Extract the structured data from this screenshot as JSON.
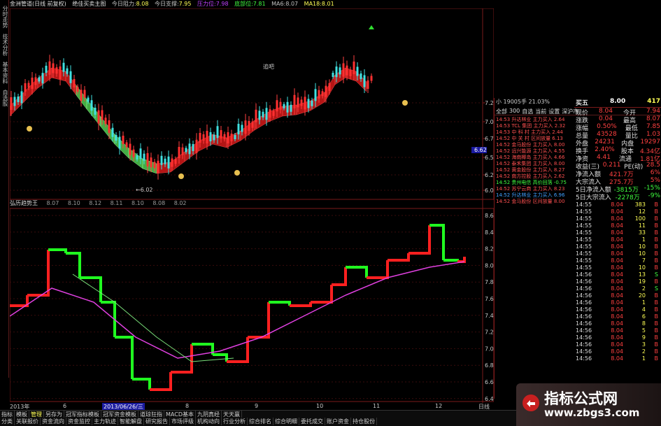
{
  "left_rail": [
    "分时走势",
    "技术分析",
    "基本资料",
    "自选股"
  ],
  "top_bar": {
    "title": "金洲管道(日线 前复权)",
    "indicator": "绝佳买卖主图",
    "today_pressure_label": "今日阻力:",
    "today_pressure": "8.08",
    "today_support_label": "今日支撑:",
    "today_support": "7.95",
    "pressure_label": "压力位:",
    "pressure": "7.98",
    "support_label": "底部位:",
    "support": "7.81",
    "ma6_label": "MA6:",
    "ma6": "8.07",
    "ma18_label": "MA18:",
    "ma18": "8.01"
  },
  "main_chart": {
    "price_axis": [
      "7.25",
      "7.00",
      "6.75",
      "6.50",
      "6.25",
      "6.00"
    ],
    "current_price_tag": "6.62",
    "low_label": "←6.02",
    "annotation": "追吧"
  },
  "indicator_bar": {
    "name": "弘历趋势王",
    "values": [
      "8.07",
      "8.10",
      "8.12",
      "8.11",
      "8.10",
      "8.08",
      "8.02"
    ]
  },
  "indicator_axis": [
    "8.60",
    "8.40",
    "8.20",
    "8.00",
    "7.80",
    "7.60",
    "7.40",
    "7.20",
    "7.00",
    "6.80",
    "6.60",
    "6.40"
  ],
  "date_axis": {
    "year": "2013年",
    "labels": [
      "6",
      "7",
      "8",
      "9",
      "10",
      "11",
      "12",
      "日线"
    ],
    "cursor_date": "2013/06/26/三"
  },
  "right_panel": {
    "head": "小 19005手 21.03%",
    "tabs": [
      "全部",
      "300",
      "自选",
      "当前",
      "设置",
      "深沪市"
    ],
    "rank_rows": [
      "14:53 升达林业 主力买入 2.64",
      "14:53 TCL 集团 主力买入 2.32",
      "14:53 中 科 村 主力买入 2.44",
      "14:52 中 关 村 区间放量 6.13",
      "14:52 金马股份 主力买入 8.00",
      "14:52 远兴能源 主力买入 4.55",
      "14:52 海南椰岛 主力买入 4.66",
      "14:52 泰禾集团 主力买入 8.00",
      "14:52 黄金股份 主力买入 8.27",
      "14:52 南方控股 主力买入 2.62",
      "14:52 贵州电信 高价回落 -0.75",
      "14:52 苏宁云商 主力买入 8.23",
      "14:52 升达林业 主力买入 6.96",
      "14:52 金马股份 区间放量 8.00"
    ],
    "quote_head": {
      "label": "买五",
      "price": "8.00",
      "vol": "417"
    },
    "quote_rows": [
      [
        "现价",
        "8.04",
        "今开",
        "7.94"
      ],
      [
        "涨跌",
        "0.04",
        "最高",
        "8.07"
      ],
      [
        "涨幅",
        "0.50%",
        "最低",
        "7.85"
      ],
      [
        "总量",
        "43528",
        "量比",
        "1.03"
      ],
      [
        "外盘",
        "24231",
        "内盘",
        "19297"
      ],
      [
        "换手",
        "2.40%",
        "股本",
        "4.34亿"
      ],
      [
        "净资",
        "4.41",
        "流通",
        "1.81亿"
      ],
      [
        "收益(三)",
        "0.211",
        "PE(动)",
        "28.5"
      ],
      [
        "净流入额",
        "421.7万",
        "",
        "6%"
      ],
      [
        "大宗流入",
        "275.7万",
        "",
        "5%"
      ],
      [
        "5日净流入额",
        "-3815万",
        "",
        "-15%"
      ],
      [
        "5日大宗流入",
        "-2278万",
        "",
        "-9%"
      ]
    ],
    "trades": [
      [
        "14:55",
        "8.04",
        "383",
        "B"
      ],
      [
        "14:55",
        "8.04",
        "12",
        "B"
      ],
      [
        "14:55",
        "8.04",
        "100",
        "B"
      ],
      [
        "14:55",
        "8.04",
        "11",
        "B"
      ],
      [
        "14:55",
        "8.04",
        "33",
        "B"
      ],
      [
        "14:55",
        "8.04",
        "1",
        "B"
      ],
      [
        "14:55",
        "8.04",
        "10",
        "B"
      ],
      [
        "14:55",
        "8.04",
        "10",
        "B"
      ],
      [
        "14:55",
        "8.04",
        "7",
        "B"
      ],
      [
        "14:55",
        "8.04",
        "10",
        "B"
      ],
      [
        "14:56",
        "8.04",
        "13",
        "S"
      ],
      [
        "14:56",
        "8.04",
        "19",
        "B"
      ],
      [
        "14:56",
        "8.04",
        "2",
        "S"
      ],
      [
        "14:56",
        "8.04",
        "20",
        "B"
      ],
      [
        "14:56",
        "8.04",
        "1",
        "B"
      ],
      [
        "14:56",
        "8.04",
        "4",
        "B"
      ],
      [
        "14:56",
        "8.04",
        "6",
        "B"
      ],
      [
        "14:56",
        "8.04",
        "8",
        "B"
      ],
      [
        "14:56",
        "8.04",
        "5",
        "B"
      ],
      [
        "14:56",
        "8.04",
        "9",
        "B"
      ],
      [
        "14:56",
        "8.04",
        "3",
        "B"
      ],
      [
        "14:56",
        "8.04",
        "2",
        "B"
      ],
      [
        "14:56",
        "8.04",
        "1",
        "B"
      ]
    ]
  },
  "bottom_tabs_1": [
    "指标",
    "模板",
    "管理",
    "另存为",
    "冠军指标模板",
    "冠军资金模板",
    "道琼狂指",
    "MACD基本",
    "九阴真经",
    "天天赢"
  ],
  "bottom_tabs_2": [
    "分类",
    "关联报价",
    "资金流向",
    "资金监控",
    "主力轨迹",
    "智能解盘",
    "研究报告",
    "市场评级",
    "机构动向",
    "行业分析",
    "综合排名",
    "综合明细",
    "委托成交",
    "账户资金",
    "持仓股份"
  ],
  "watermark": {
    "title": "指标公式网",
    "url": "www.zbgs3.com"
  },
  "colors": {
    "up": "#ff2020",
    "down": "#20ff20",
    "ma": "#e040e0",
    "grid": "#7a1a1a",
    "label_yellow": "#ffff55"
  }
}
